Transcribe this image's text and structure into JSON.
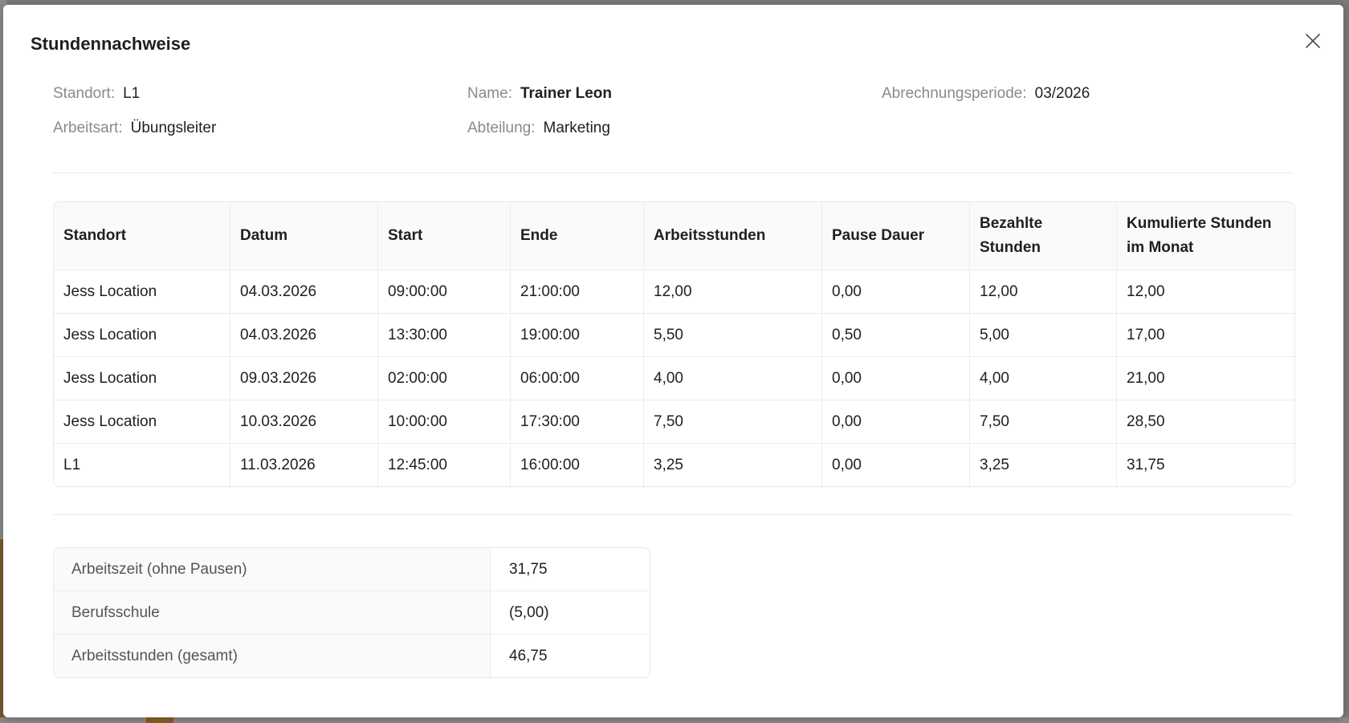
{
  "modal": {
    "title": "Stundennachweise",
    "close_icon": "close-icon"
  },
  "info": {
    "standort_label": "Standort",
    "standort_value": "L1",
    "arbeitsart_label": "Arbeitsart",
    "arbeitsart_value": "Übungsleiter",
    "name_label": "Name",
    "name_value": "Trainer Leon",
    "abteilung_label": "Abteilung",
    "abteilung_value": "Marketing",
    "periode_label": "Abrechnungsperiode",
    "periode_value": "03/2026",
    "separator": ":"
  },
  "table": {
    "headers": [
      "Standort",
      "Datum",
      "Start",
      "Ende",
      "Arbeitsstunden",
      "Pause Dauer",
      "Bezahlte Stunden",
      "Kumulierte Stunden im Monat"
    ],
    "rows": [
      [
        "Jess Location",
        "04.03.2026",
        "09:00:00",
        "21:00:00",
        "12,00",
        "0,00",
        "12,00",
        "12,00"
      ],
      [
        "Jess Location",
        "04.03.2026",
        "13:30:00",
        "19:00:00",
        "5,50",
        "0,50",
        "5,00",
        "17,00"
      ],
      [
        "Jess Location",
        "09.03.2026",
        "02:00:00",
        "06:00:00",
        "4,00",
        "0,00",
        "4,00",
        "21,00"
      ],
      [
        "Jess Location",
        "10.03.2026",
        "10:00:00",
        "17:30:00",
        "7,50",
        "0,00",
        "7,50",
        "28,50"
      ],
      [
        "L1",
        "11.03.2026",
        "12:45:00",
        "16:00:00",
        "3,25",
        "0,00",
        "3,25",
        "31,75"
      ]
    ]
  },
  "summary": [
    {
      "label": "Arbeitszeit (ohne Pausen)",
      "value": "31,75"
    },
    {
      "label": "Berufsschule",
      "value": "(5,00)"
    },
    {
      "label": "Arbeitsstunden (gesamt)",
      "value": "46,75"
    }
  ]
}
